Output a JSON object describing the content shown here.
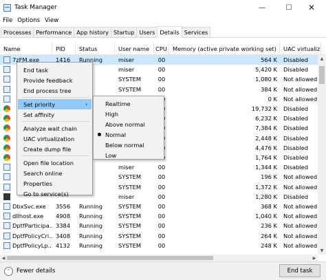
{
  "window": {
    "title": "Task Manager",
    "icon": "task-manager-icon",
    "minimize": "—",
    "maximize": "☐",
    "close": "✕"
  },
  "menu": [
    "File",
    "Options",
    "View"
  ],
  "tabs": [
    {
      "label": "Processes"
    },
    {
      "label": "Performance"
    },
    {
      "label": "App history"
    },
    {
      "label": "Startup"
    },
    {
      "label": "Users"
    },
    {
      "label": "Details",
      "active": true
    },
    {
      "label": "Services"
    }
  ],
  "columns": [
    "Name",
    "PID",
    "Status",
    "User name",
    "CPU",
    "Memory (active private working set)",
    "UAC virtualiz"
  ],
  "rows": [
    {
      "name": "7zFM.exe",
      "pid": "1416",
      "status": "Running",
      "user": "miser",
      "cpu": "00",
      "mem": "564 K",
      "uac": "Disabled",
      "icon": "app",
      "selected": true
    },
    {
      "name": "",
      "pid": "",
      "status": "",
      "user": "miser",
      "cpu": "00",
      "mem": "5,420 K",
      "uac": "Disabled",
      "icon": "app"
    },
    {
      "name": "",
      "pid": "",
      "status": "",
      "user": "SYSTEM",
      "cpu": "00",
      "mem": "1,080 K",
      "uac": "Not allowed",
      "icon": "app"
    },
    {
      "name": "",
      "pid": "",
      "status": "",
      "user": "SYSTEM",
      "cpu": "00",
      "mem": "384 K",
      "uac": "Not allowed",
      "icon": "app"
    },
    {
      "name": "",
      "pid": "",
      "status": "",
      "user": "",
      "cpu": "00",
      "mem": "0 K",
      "uac": "Not allowed",
      "icon": "app"
    },
    {
      "name": "",
      "pid": "",
      "status": "",
      "user": "",
      "cpu": "00",
      "mem": "19,732 K",
      "uac": "Disabled",
      "icon": "chrome"
    },
    {
      "name": "",
      "pid": "",
      "status": "",
      "user": "",
      "cpu": "00",
      "mem": "6,232 K",
      "uac": "Disabled",
      "icon": "chrome"
    },
    {
      "name": "",
      "pid": "",
      "status": "",
      "user": "",
      "cpu": "00",
      "mem": "7,384 K",
      "uac": "Disabled",
      "icon": "chrome"
    },
    {
      "name": "",
      "pid": "",
      "status": "",
      "user": "",
      "cpu": "00",
      "mem": "2,448 K",
      "uac": "Disabled",
      "icon": "chrome"
    },
    {
      "name": "",
      "pid": "",
      "status": "",
      "user": "",
      "cpu": "00",
      "mem": "4,476 K",
      "uac": "Disabled",
      "icon": "chrome"
    },
    {
      "name": "",
      "pid": "",
      "status": "",
      "user": "",
      "cpu": "00",
      "mem": "1,764 K",
      "uac": "Disabled",
      "icon": "chrome"
    },
    {
      "name": "",
      "pid": "",
      "status": "",
      "user": "miser",
      "cpu": "00",
      "mem": "1,344 K",
      "uac": "Disabled",
      "icon": "app"
    },
    {
      "name": "",
      "pid": "",
      "status": "",
      "user": "SYSTEM",
      "cpu": "00",
      "mem": "196 K",
      "uac": "Not allowed",
      "icon": "app"
    },
    {
      "name": "",
      "pid": "",
      "status": "",
      "user": "SYSTEM",
      "cpu": "00",
      "mem": "1,372 K",
      "uac": "Not allowed",
      "icon": "app"
    },
    {
      "name": "",
      "pid": "",
      "status": "",
      "user": "miser",
      "cpu": "00",
      "mem": "1,280 K",
      "uac": "Disabled",
      "icon": "cmd"
    },
    {
      "name": "DbxSvc.exe",
      "pid": "3556",
      "status": "Running",
      "user": "SYSTEM",
      "cpu": "00",
      "mem": "368 K",
      "uac": "Not allowed",
      "icon": "app"
    },
    {
      "name": "dllhost.exe",
      "pid": "4908",
      "status": "Running",
      "user": "SYSTEM",
      "cpu": "00",
      "mem": "1,040 K",
      "uac": "Not allowed",
      "icon": "app"
    },
    {
      "name": "DptfParticipa...",
      "pid": "3384",
      "status": "Running",
      "user": "SYSTEM",
      "cpu": "00",
      "mem": "236 K",
      "uac": "Not allowed",
      "icon": "app"
    },
    {
      "name": "DptfPolicyCri...",
      "pid": "3408",
      "status": "Running",
      "user": "SYSTEM",
      "cpu": "00",
      "mem": "264 K",
      "uac": "Not allowed",
      "icon": "app"
    },
    {
      "name": "DptfPolicyLp...",
      "pid": "4132",
      "status": "Running",
      "user": "SYSTEM",
      "cpu": "00",
      "mem": "248 K",
      "uac": "Not allowed",
      "icon": "app"
    }
  ],
  "context_menu": {
    "groups": [
      [
        "End task",
        "Provide feedback",
        "End process tree"
      ],
      [
        "Set priority",
        "Set affinity"
      ],
      [
        "Analyze wait chain",
        "UAC virtualization",
        "Create dump file"
      ],
      [
        "Open file location",
        "Search online",
        "Properties",
        "Go to service(s)"
      ]
    ],
    "highlighted": "Set priority",
    "submenu_arrow": "›"
  },
  "priority_submenu": {
    "items": [
      "Realtime",
      "High",
      "Above normal",
      "Normal",
      "Below normal",
      "Low"
    ],
    "checked": "Normal"
  },
  "footer": {
    "fewer_details": "Fewer details",
    "fewer_icon": "chevron-up-icon",
    "end_task": "End task"
  },
  "colors": {
    "selection": "#cce8ff",
    "menu_highlight": "#91c9f7"
  }
}
